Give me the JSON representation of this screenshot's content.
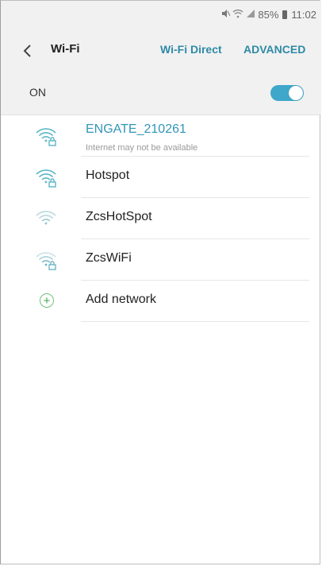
{
  "status": {
    "battery_text": "85%",
    "time": "11:02",
    "icons": [
      "mute-icon",
      "wifi-status-icon",
      "signal-icon",
      "battery-icon"
    ]
  },
  "header": {
    "back_icon": "chevron-left-icon",
    "title": "Wi-Fi",
    "wifi_direct_label": "Wi-Fi Direct",
    "advanced_label": "ADVANCED"
  },
  "toggle_row": {
    "label": "ON",
    "enabled": true
  },
  "networks": [
    {
      "name": "ENGATE_210261",
      "status": "Internet may not be available",
      "icon": "wifi-lock-icon",
      "connected": true
    },
    {
      "name": "Hotspot",
      "icon": "wifi-lock-icon"
    },
    {
      "name": "ZcsHotSpot",
      "icon": "wifi-icon"
    },
    {
      "name": "ZcsWiFi",
      "icon": "wifi-lock-icon"
    }
  ],
  "add_network": {
    "label": "Add network",
    "icon": "plus-icon"
  },
  "colors": {
    "accent": "#2f8aa6",
    "toggle_on": "#3fa7c9",
    "connected_name": "#3196b6",
    "add_icon": "#3fa64a"
  }
}
